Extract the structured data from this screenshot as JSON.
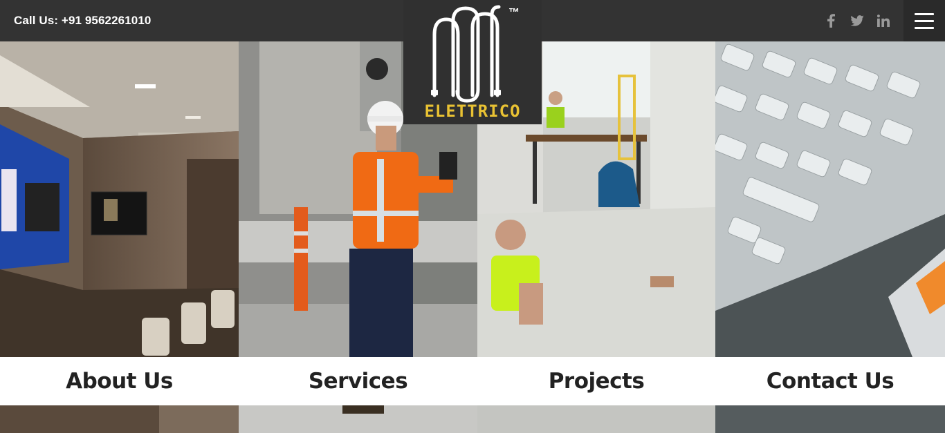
{
  "header": {
    "call_text": "Call Us: +91 9562261010",
    "social": [
      {
        "icon": "facebook-icon",
        "glyph": "f"
      },
      {
        "icon": "twitter-icon",
        "glyph": "🐦"
      },
      {
        "icon": "linkedin-icon",
        "glyph": "in"
      }
    ],
    "menu_icon": "hamburger-menu-icon"
  },
  "logo": {
    "word": "ELETTRICO",
    "trademark": "™",
    "accent_color": "#e9c233"
  },
  "panels": [
    {
      "label": "About Us"
    },
    {
      "label": "Services"
    },
    {
      "label": "Projects"
    },
    {
      "label": "Contact Us"
    }
  ],
  "colors": {
    "topbar": "#333333",
    "label_band": "#ffffff",
    "label_text": "#222222"
  }
}
